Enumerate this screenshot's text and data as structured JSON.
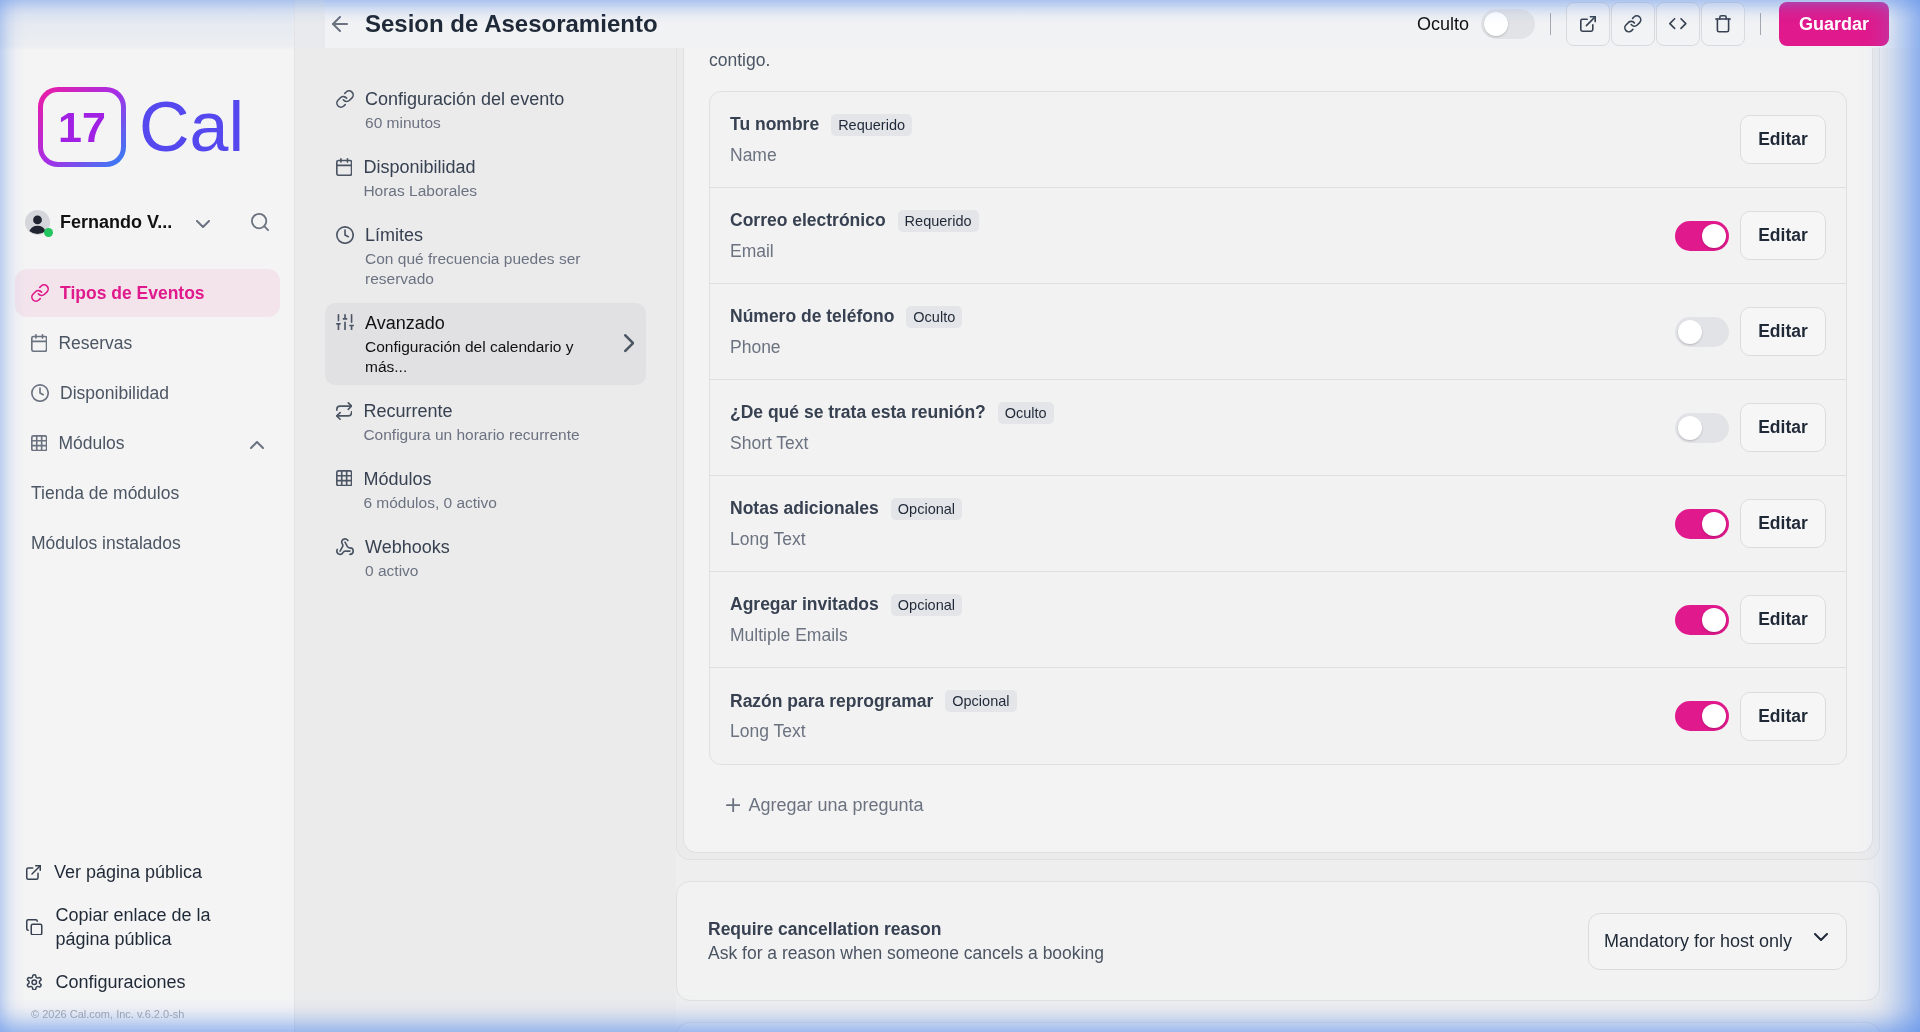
{
  "sidebar": {
    "logo": {
      "mark": "17",
      "text": "Cal"
    },
    "user": {
      "name": "Fernando V...",
      "online": true
    },
    "nav": [
      {
        "label": "Tipos de Eventos",
        "selected": true
      },
      {
        "label": "Reservas",
        "selected": false
      },
      {
        "label": "Disponibilidad",
        "selected": false
      },
      {
        "label": "Módulos",
        "selected": false,
        "expanded": true,
        "children": [
          {
            "label": "Tienda de módulos",
            "selected": false
          },
          {
            "label": "Módulos instalados",
            "selected": false
          }
        ]
      }
    ],
    "footer_links": [
      "Ver página pública",
      "Copiar enlace de la página pública",
      "Configuraciones"
    ],
    "copyright": "© 2026 Cal.com, Inc. v.6.2.0-sh"
  },
  "header": {
    "title": "Sesion de Asesoramiento",
    "visibility": {
      "label": "Oculto",
      "on": false
    },
    "save_button": "Guardar"
  },
  "event_menu": [
    {
      "title": "Configuración del evento",
      "subtitle": "60 minutos",
      "selected": false
    },
    {
      "title": "Disponibilidad",
      "subtitle": "Horas Laborales",
      "selected": false
    },
    {
      "title": "Límites",
      "subtitle": "Con qué frecuencia puedes ser reservado",
      "selected": false
    },
    {
      "title": "Avanzado",
      "subtitle": "Configuración del calendario y más...",
      "selected": true
    },
    {
      "title": "Recurrente",
      "subtitle": "Configura un horario recurrente",
      "selected": false
    },
    {
      "title": "Módulos",
      "subtitle": "6 módulos, 0 activo",
      "selected": false
    },
    {
      "title": "Webhooks",
      "subtitle": "0 activo",
      "selected": false
    }
  ],
  "booking_questions": {
    "intro_tail": "contigo.",
    "questions": [
      {
        "label": "Tu nombre",
        "badge": "Requerido",
        "type": "Name",
        "edit_button": "Editar"
      },
      {
        "label": "Correo electrónico",
        "badge": "Requerido",
        "type": "Email",
        "on": true,
        "edit_button": "Editar"
      },
      {
        "label": "Número de teléfono",
        "badge": "Oculto",
        "type": "Phone",
        "on": false,
        "edit_button": "Editar"
      },
      {
        "label": "¿De qué se trata esta reunión?",
        "badge": "Oculto",
        "type": "Short Text",
        "on": false,
        "edit_button": "Editar"
      },
      {
        "label": "Notas adicionales",
        "badge": "Opcional",
        "type": "Long Text",
        "on": true,
        "edit_button": "Editar"
      },
      {
        "label": "Agregar invitados",
        "badge": "Opcional",
        "type": "Multiple Emails",
        "on": true,
        "edit_button": "Editar"
      },
      {
        "label": "Razón para reprogramar",
        "badge": "Opcional",
        "type": "Long Text",
        "on": true,
        "edit_button": "Editar"
      }
    ],
    "add_button": "Agregar una pregunta"
  },
  "cancellation_reason": {
    "title": "Require cancellation reason",
    "description": "Ask for a reason when someone cancels a booking",
    "value": "Mandatory for host only"
  }
}
